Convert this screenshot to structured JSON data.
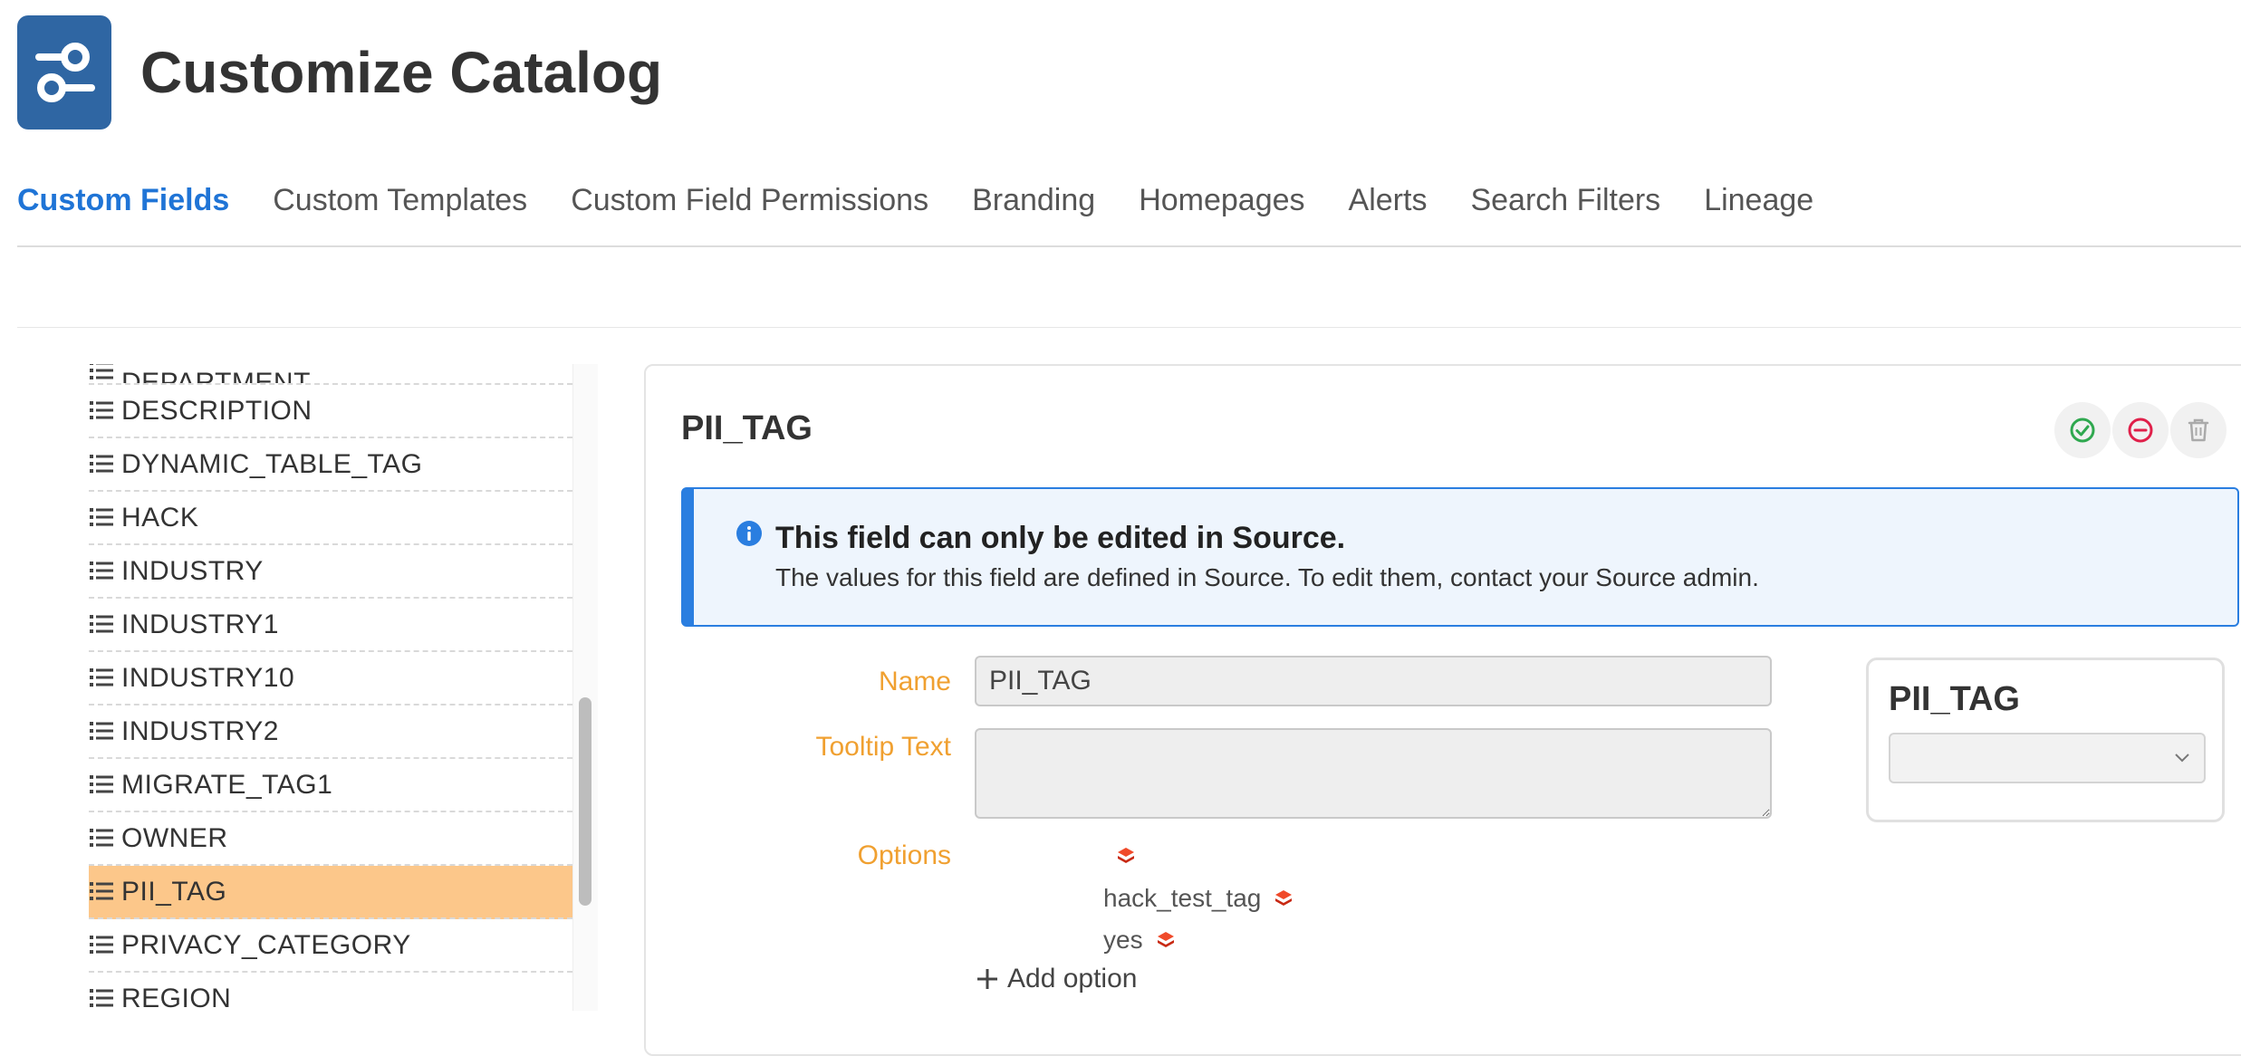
{
  "header": {
    "title": "Customize Catalog",
    "app_icon": "toggle-settings-icon"
  },
  "tabs": [
    {
      "label": "Custom Fields",
      "active": true
    },
    {
      "label": "Custom Templates",
      "active": false
    },
    {
      "label": "Custom Field Permissions",
      "active": false
    },
    {
      "label": "Branding",
      "active": false
    },
    {
      "label": "Homepages",
      "active": false
    },
    {
      "label": "Alerts",
      "active": false
    },
    {
      "label": "Search Filters",
      "active": false
    },
    {
      "label": "Lineage",
      "active": false
    }
  ],
  "sidebar": {
    "items": [
      {
        "label": "DEPARTMENT"
      },
      {
        "label": "DESCRIPTION"
      },
      {
        "label": "DYNAMIC_TABLE_TAG"
      },
      {
        "label": "HACK"
      },
      {
        "label": "INDUSTRY"
      },
      {
        "label": "INDUSTRY1"
      },
      {
        "label": "INDUSTRY10"
      },
      {
        "label": "INDUSTRY2"
      },
      {
        "label": "MIGRATE_TAG1"
      },
      {
        "label": "OWNER"
      },
      {
        "label": "PII_TAG"
      },
      {
        "label": "PRIVACY_CATEGORY"
      },
      {
        "label": "REGION"
      }
    ],
    "selected": "PII_TAG",
    "item_icon": "list-icon"
  },
  "detail": {
    "title": "PII_TAG",
    "actions": {
      "save_icon": "check-circle-icon",
      "cancel_icon": "minus-circle-icon",
      "delete_icon": "trash-icon"
    },
    "banner": {
      "title": "This field can only be edited in Source.",
      "text": "The values for this field are defined in Source. To edit them, contact your Source admin."
    },
    "form": {
      "name_label": "Name",
      "name_value": "PII_TAG",
      "tooltip_label": "Tooltip Text",
      "tooltip_value": "",
      "options_label": "Options",
      "options": [
        "",
        "hack_test_tag",
        "yes"
      ],
      "add_option_label": "Add option"
    },
    "preview": {
      "title": "PII_TAG",
      "select_value": ""
    }
  },
  "colors": {
    "accent": "#1f74d6",
    "label": "#f0a030",
    "selected_row": "#fcc78a",
    "info": "#2a7ee0",
    "brand": "#2f66a3"
  }
}
